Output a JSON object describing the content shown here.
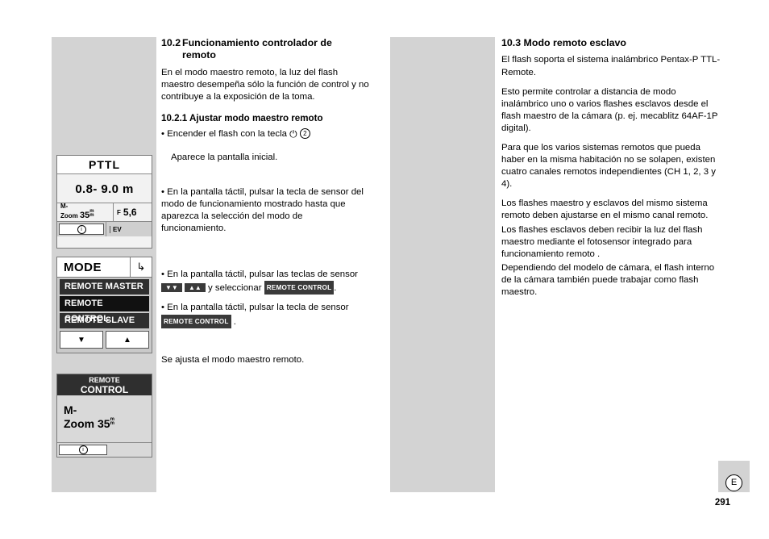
{
  "page": {
    "number": "291",
    "language_code": "E"
  },
  "columns": {
    "left": {
      "heading": "10.2 Funcionamiento controlador de remoto",
      "para1": "En el modo maestro remoto, la luz del flash maestro desempeña sólo la función de control y no contribuye a la exposición de la toma.",
      "subheading": "10.2.1 Ajustar modo maestro remoto",
      "bullet1_pre": "• Encender el flash con la tecla",
      "bullet1_circle": "2",
      "note1": "Aparece la pantalla inicial.",
      "bullet2": "• En la pantalla táctil, pulsar la tecla de sensor del modo de funcionamiento mostrado hasta que aparezca la selección del modo de funcionamiento.",
      "bullet3_pre": "• En la pantalla táctil, pulsar las teclas de sensor",
      "bullet3_mid": "y seleccionar",
      "bullet3_key": "REMOTE CONTROL",
      "bullet3_end": ".",
      "bullet4_pre": "• En la pantalla táctil, pulsar la tecla de sensor",
      "bullet4_key": "REMOTE CONTROL",
      "bullet4_end": ".",
      "closing": "Se ajusta el modo maestro remoto."
    },
    "right": {
      "heading": "10.3 Modo remoto esclavo",
      "para1": "El flash soporta el sistema inalámbrico Pentax-P TTL-Remote.",
      "para2": "Esto permite controlar a distancia de modo inalámbrico uno o varios flashes esclavos desde el flash maestro de la cámara (p. ej. mecablitz 64AF-1P digital).",
      "para3": "Para que los varios sistemas remotos que pueda haber en la misma habitación no se solapen, existen cuatro canales remotos independientes (CH 1, 2, 3 y 4).",
      "para4": "Los flashes maestro y esclavos del mismo sistema remoto deben ajustarse en el mismo canal remoto.",
      "para5": "Los flashes esclavos deben recibir la luz del flash maestro mediante el fotosensor integrado para funcionamiento remoto .",
      "para6": "Dependiendo del modelo de cámara, el flash interno de la cámara también puede trabajar como flash maestro."
    }
  },
  "lcd_initial": {
    "title": "PTTL",
    "distance": "0.8- 9.0 m",
    "m_label": "M-",
    "zoom_label": "Zoom",
    "zoom_value": "35",
    "zoom_unit": "m\nm",
    "f_tag": "F",
    "f_value": "5,6",
    "info_icon": "i",
    "ev_label": "EV"
  },
  "lcd_mode": {
    "title": "MODE",
    "return_icon": "return-arrow",
    "items": [
      {
        "label": "REMOTE MASTER"
      },
      {
        "label": "REMOTE CONTROL"
      },
      {
        "label": "REMOTE SLAVE"
      }
    ],
    "arrow_down": "▼",
    "arrow_up": "▲"
  },
  "lcd_remote": {
    "head_line1": "REMOTE",
    "head_line2": "CONTROL",
    "body_line1": "M-",
    "body_line2_pre": "Zoom",
    "body_line2_value": "35",
    "info_icon": "i"
  }
}
